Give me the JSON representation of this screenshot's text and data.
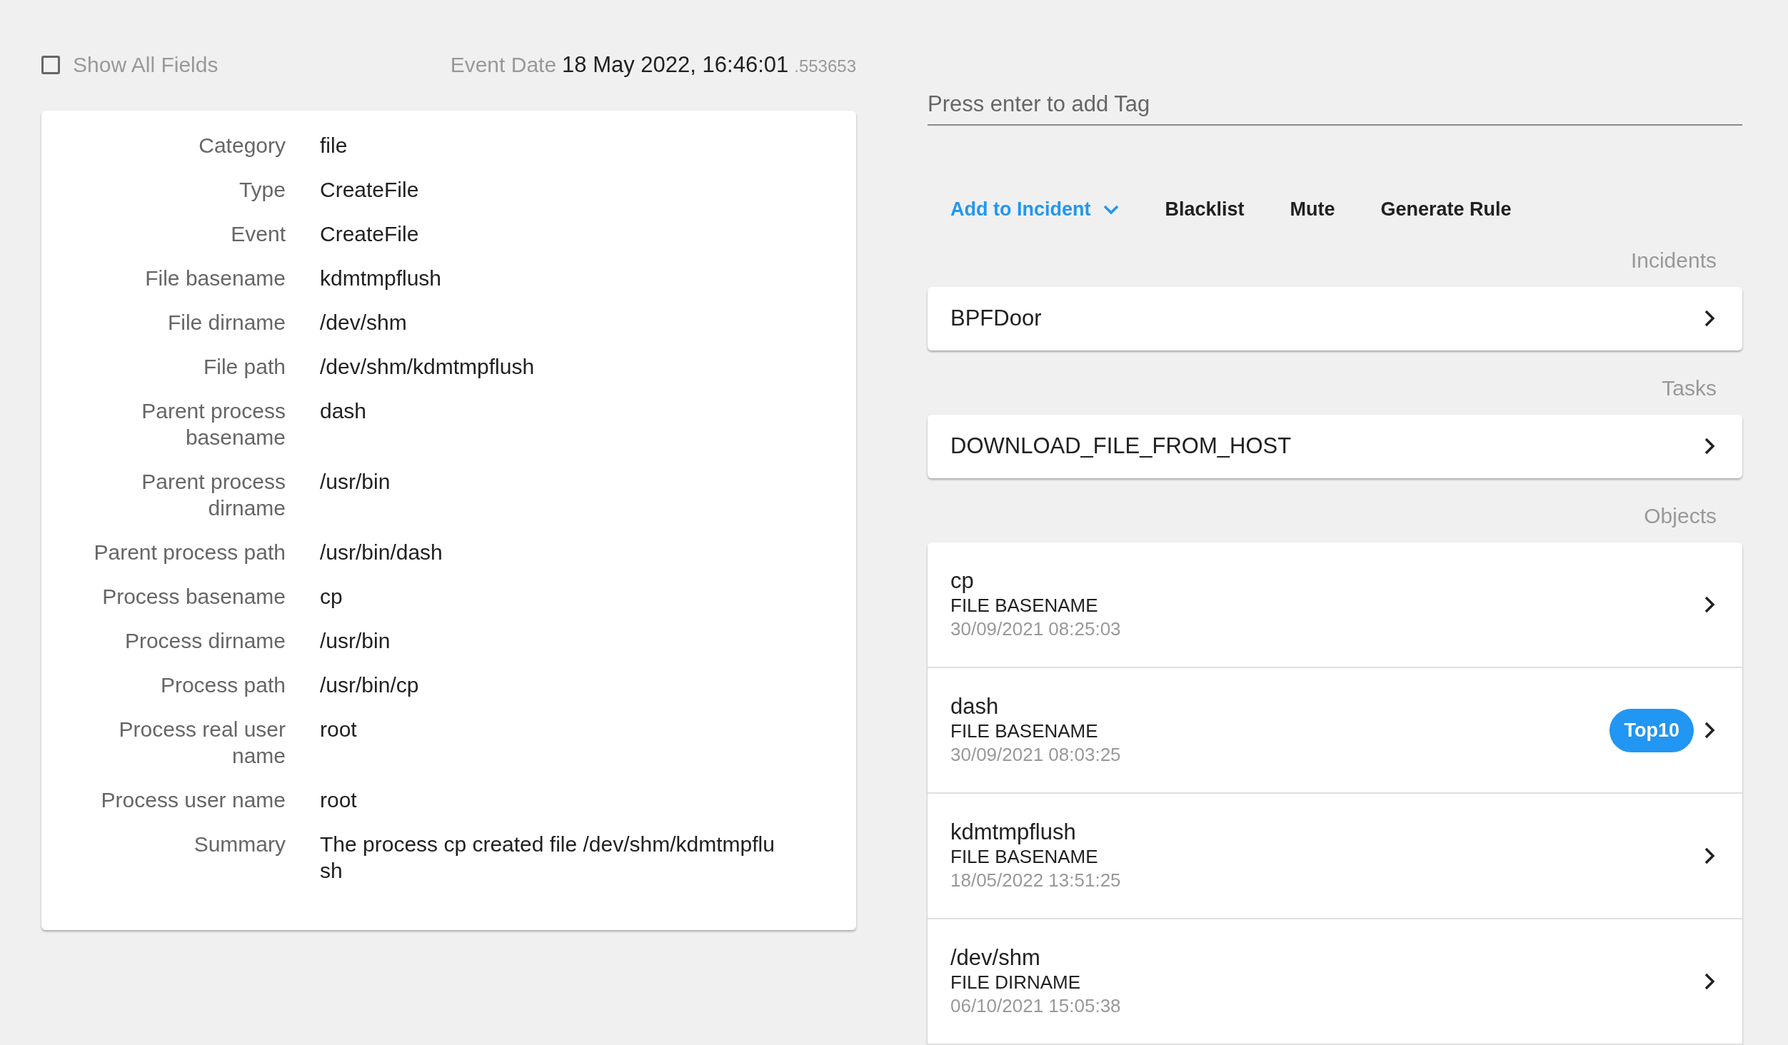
{
  "show_all_fields": {
    "label": "Show All Fields",
    "checked": false
  },
  "event_date": {
    "label": "Event Date",
    "value": "18 May 2022, 16:46:01",
    "fraction": ".553653"
  },
  "field_groups": [
    [
      {
        "label": "Category",
        "value": "file"
      },
      {
        "label": "Type",
        "value": "CreateFile"
      }
    ],
    [
      {
        "label": "Event",
        "value": "CreateFile"
      },
      {
        "label": "File basename",
        "value": "kdmtmpflush"
      },
      {
        "label": "File dirname",
        "value": "/dev/shm"
      },
      {
        "label": "File path",
        "value": "/dev/shm/kdmtmpflush"
      },
      {
        "label": "Parent process basename",
        "value": "dash"
      },
      {
        "label": "Parent process dirname",
        "value": "/usr/bin"
      },
      {
        "label": "Parent process path",
        "value": "/usr/bin/dash"
      },
      {
        "label": "Process basename",
        "value": "cp"
      },
      {
        "label": "Process dirname",
        "value": "/usr/bin"
      },
      {
        "label": "Process path",
        "value": "/usr/bin/cp"
      },
      {
        "label": "Process real user name",
        "value": "root"
      },
      {
        "label": "Process user name",
        "value": "root"
      },
      {
        "label": "Summary",
        "value": "The process cp created file /dev/shm/kdmtmpflush"
      }
    ]
  ],
  "tag_field": {
    "placeholder": "Press enter to add Tag"
  },
  "actions": [
    {
      "label": "Add to Incident",
      "kind": "dropdown"
    },
    {
      "label": "Blacklist",
      "kind": "plain"
    },
    {
      "label": "Mute",
      "kind": "plain"
    },
    {
      "label": "Generate Rule",
      "kind": "plain"
    }
  ],
  "incidents": {
    "heading": "Incidents",
    "items": [
      {
        "name": "BPFDoor"
      }
    ]
  },
  "tasks": {
    "heading": "Tasks",
    "items": [
      {
        "name": "DOWNLOAD_FILE_FROM_HOST"
      }
    ]
  },
  "objects": {
    "heading": "Objects",
    "items": [
      {
        "name": "cp",
        "type": "FILE BASENAME",
        "date": "30/09/2021 08:25:03"
      },
      {
        "name": "dash",
        "type": "FILE BASENAME",
        "date": "30/09/2021 08:03:25",
        "badge": "Top10"
      },
      {
        "name": "kdmtmpflush",
        "type": "FILE BASENAME",
        "date": "18/05/2022 13:51:25"
      },
      {
        "name": "/dev/shm",
        "type": "FILE DIRNAME",
        "date": "06/10/2021 15:05:38"
      }
    ]
  }
}
